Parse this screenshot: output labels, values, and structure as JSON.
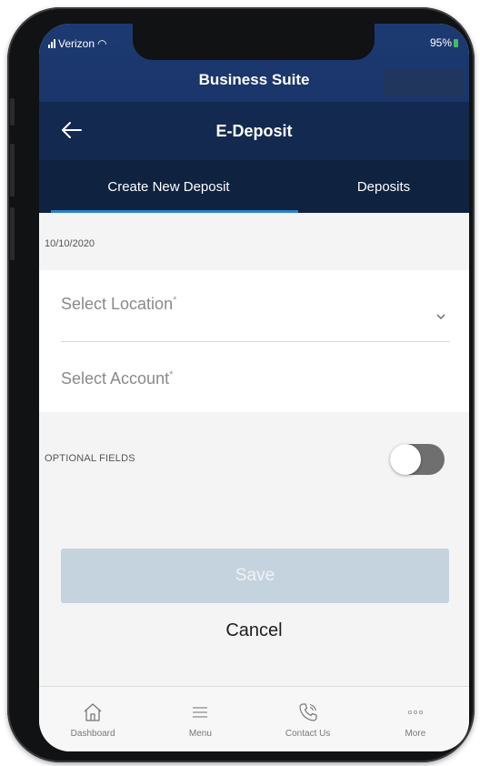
{
  "status": {
    "carrier": "Verizon",
    "battery": "95%"
  },
  "app": {
    "title": "Business Suite"
  },
  "page": {
    "title": "E-Deposit"
  },
  "tabs": [
    {
      "label": "Create New Deposit",
      "active": true
    },
    {
      "label": "Deposits",
      "active": false
    }
  ],
  "form": {
    "date": "10/10/2020",
    "location_placeholder": "Select Location",
    "account_placeholder": "Select Account",
    "required_marker": "*",
    "optional_label": "OPTIONAL FIELDS",
    "optional_enabled": false
  },
  "actions": {
    "save_label": "Save",
    "cancel_label": "Cancel"
  },
  "bottom_nav": [
    {
      "label": "Dashboard",
      "icon": "home-icon"
    },
    {
      "label": "Menu",
      "icon": "menu-icon"
    },
    {
      "label": "Contact Us",
      "icon": "phone-icon"
    },
    {
      "label": "More",
      "icon": "more-icon"
    }
  ],
  "colors": {
    "header": "#1c3a72",
    "tabs": "#0f2240",
    "accent": "#2a7fd4",
    "save_disabled": "#c5d3df"
  }
}
